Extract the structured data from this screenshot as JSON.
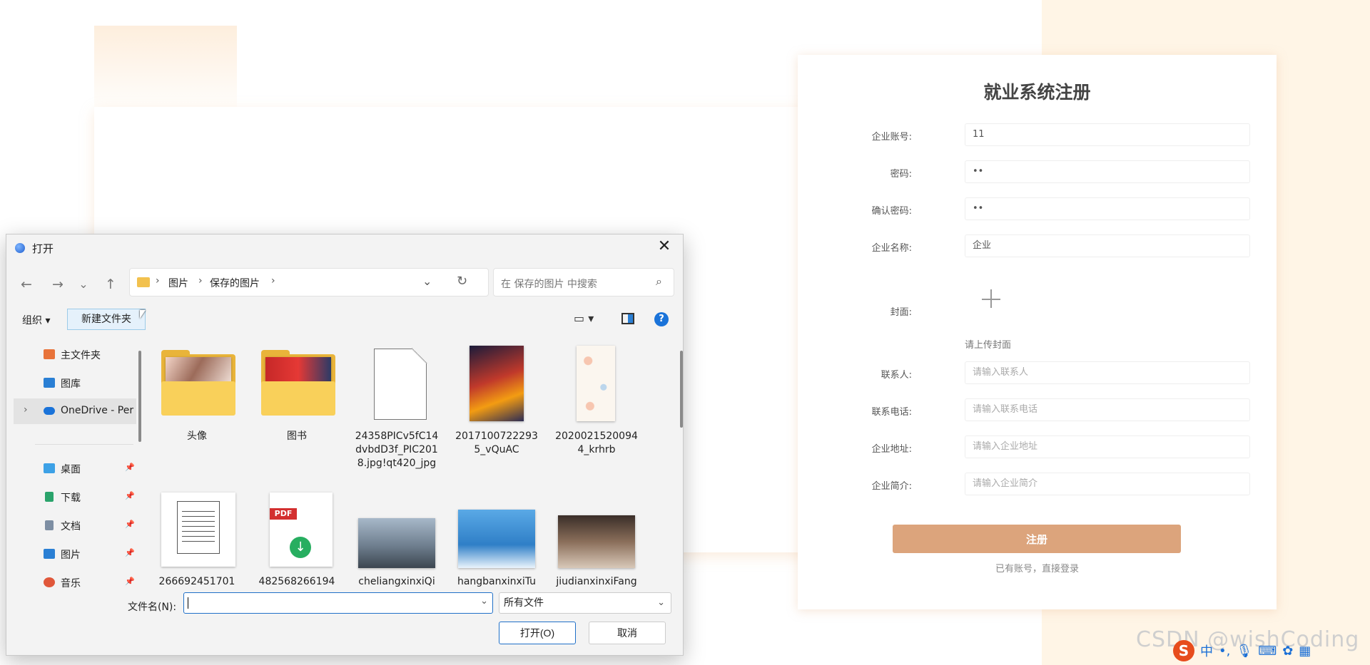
{
  "registration": {
    "title": "就业系统注册",
    "fields": [
      {
        "label": "企业账号:",
        "value": "11",
        "placeholder": ""
      },
      {
        "label": "密码:",
        "value": "••",
        "placeholder": ""
      },
      {
        "label": "确认密码:",
        "value": "••",
        "placeholder": ""
      },
      {
        "label": "企业名称:",
        "value": "企业",
        "placeholder": ""
      }
    ],
    "cover_label": "封面:",
    "cover_hint": "请上传封面",
    "fields2": [
      {
        "label": "联系人:",
        "placeholder": "请输入联系人"
      },
      {
        "label": "联系电话:",
        "placeholder": "请输入联系电话"
      },
      {
        "label": "企业地址:",
        "placeholder": "请输入企业地址"
      },
      {
        "label": "企业简介:",
        "placeholder": "请输入企业简介"
      }
    ],
    "submit_label": "注册",
    "login_link": "已有账号，直接登录"
  },
  "watermark": "CSDN @wishCoding",
  "ime": {
    "logo": "S",
    "lang": "中",
    "punct": "•,"
  },
  "dialog": {
    "title": "打开",
    "close_symbol": "✕",
    "nav": {
      "back": "←",
      "forward": "→",
      "recent": "⌄",
      "up": "↑"
    },
    "breadcrumb": [
      "图片",
      "保存的图片"
    ],
    "search_placeholder": "在 保存的图片 中搜索",
    "toolbar": {
      "organize": "组织 ▾",
      "new_folder": "新建文件夹",
      "help": "?"
    },
    "sidebar": [
      {
        "label": "主文件夹",
        "color": "#e8733a"
      },
      {
        "label": "图库",
        "color": "#2a7fd4"
      },
      {
        "label": "OneDrive - Per",
        "color": "#1a73d9"
      },
      {
        "label": "桌面",
        "color": "#3da1e6"
      },
      {
        "label": "下载",
        "color": "#2aa36b"
      },
      {
        "label": "文档",
        "color": "#7d8ea3"
      },
      {
        "label": "图片",
        "color": "#2a7fd4"
      },
      {
        "label": "音乐",
        "color": "#e0573a"
      }
    ],
    "files_row1": [
      {
        "name": "头像",
        "kind": "folder"
      },
      {
        "name": "图书",
        "kind": "folder"
      },
      {
        "name": "24358PICv5fC14dvbdD3f_PIC2018.jpg!qt420_jpg",
        "kind": "blank"
      },
      {
        "name": "20171007222935_vQuAC",
        "kind": "photo"
      },
      {
        "name": "20200215200944_krhrb",
        "kind": "photo"
      }
    ],
    "files_row2": [
      {
        "name": "266692451701",
        "kind": "doc"
      },
      {
        "name": "482568266194",
        "kind": "pdf"
      },
      {
        "name": "cheliangxinxiQi",
        "kind": "photo"
      },
      {
        "name": "hangbanxinxiTu",
        "kind": "photo"
      },
      {
        "name": "jiudianxinxiFang",
        "kind": "photo"
      }
    ],
    "pdf_badge": "PDF",
    "filename_label": "文件名(N):",
    "filename_value": "",
    "filetype": "所有文件",
    "open_label": "打开(O)",
    "cancel_label": "取消"
  }
}
